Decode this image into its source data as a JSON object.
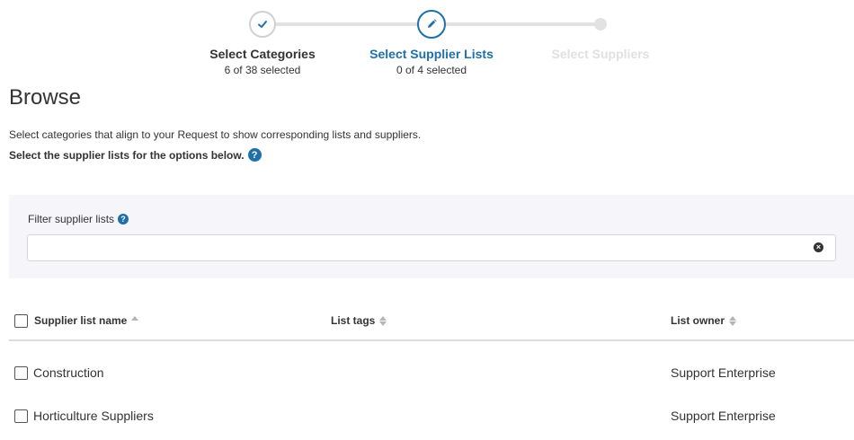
{
  "stepper": {
    "steps": [
      {
        "label": "Select Categories",
        "sub": "6 of 38 selected",
        "state": "done"
      },
      {
        "label": "Select Supplier Lists",
        "sub": "0 of 4 selected",
        "state": "active"
      },
      {
        "label": "Select Suppliers",
        "sub": "",
        "state": "pending"
      }
    ],
    "colors": {
      "active": "#1f6fa8",
      "done_border": "#d0d0d0",
      "pending": "#e0e0e0"
    }
  },
  "page": {
    "title": "Browse",
    "description": "Select categories that align to your Request to show corresponding lists and suppliers.",
    "instruction": "Select the supplier lists for the options below."
  },
  "filter": {
    "label": "Filter supplier lists",
    "value": "",
    "placeholder": ""
  },
  "table": {
    "headers": {
      "name": "Supplier list name",
      "tags": "List tags",
      "owner": "List owner"
    },
    "rows": [
      {
        "name": "Construction",
        "tags": "",
        "owner": "Support Enterprise"
      },
      {
        "name": "Horticulture Suppliers",
        "tags": "",
        "owner": "Support Enterprise"
      }
    ]
  },
  "icons": {
    "step_done": "check-icon",
    "step_active": "pencil-icon",
    "help": "question-circle-icon",
    "clear": "clear-circle-icon",
    "sort": "sort-icon"
  }
}
